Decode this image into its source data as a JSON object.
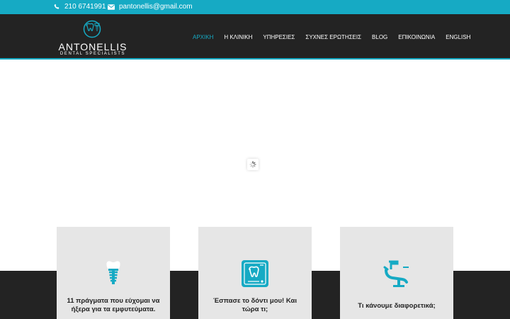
{
  "topbar": {
    "phone": "210 6741991",
    "email": "pantonellis@gmail.com",
    "phone_icon": "phone-icon",
    "email_icon": "envelope-icon"
  },
  "brand": {
    "name": "ANTONELLIS",
    "tagline": "DENTAL SPECIALISTS",
    "logo_icon": "tooth-implant-logo-icon"
  },
  "nav": {
    "items": [
      {
        "label": "ΑΡΧΙΚΗ",
        "active": true
      },
      {
        "label": "Η ΚΛΙΝΙΚΗ",
        "active": false
      },
      {
        "label": "ΥΠΗΡΕΣΙΕΣ",
        "active": false
      },
      {
        "label": "ΣΥΧΝΕΣ ΕΡΩΤΗΣΕΙΣ",
        "active": false
      },
      {
        "label": "BLOG",
        "active": false
      },
      {
        "label": "ΕΠΙΚΟΙΝΩΝΙΑ",
        "active": false
      },
      {
        "label": "ENGLISH",
        "active": false
      }
    ]
  },
  "hero": {
    "loader_icon": "loading-spinner-icon"
  },
  "cards": [
    {
      "title": "11 πράγματα που εύχομαι να ήξερα για τα εμφυτεύματα.",
      "icon": "dental-implant-icon"
    },
    {
      "title": "Έσπασε το δόντι μου! Και τώρα τι;",
      "icon": "tooth-xray-icon"
    },
    {
      "title": "Τι κάνουμε διαφορετικά;",
      "icon": "dental-chair-icon"
    }
  ],
  "colors": {
    "accent": "#16aac4",
    "header_bg": "#232323",
    "card_bg": "#e6e6e6",
    "text_dark": "#232323"
  }
}
